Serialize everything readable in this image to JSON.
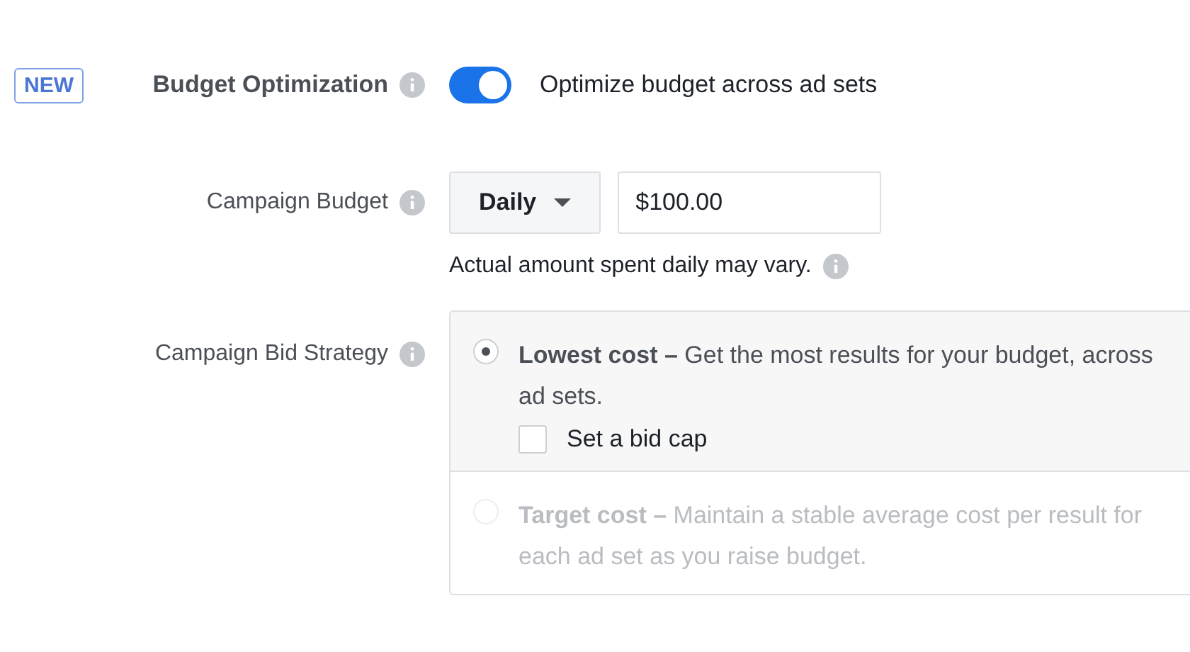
{
  "optimization": {
    "badge": "NEW",
    "label": "Budget Optimization",
    "toggle": {
      "on": true
    },
    "toggle_label": "Optimize budget across ad sets"
  },
  "budget": {
    "label": "Campaign Budget",
    "period": "Daily",
    "amount": "$100.00",
    "hint": "Actual amount spent daily may vary."
  },
  "bid_strategy": {
    "label": "Campaign Bid Strategy",
    "options": [
      {
        "text": "**Lowest cost –** Get the most results for your budget, across ad sets.",
        "selected": true,
        "disabled": false,
        "bid_cap": {
          "label": "Set a bid cap",
          "checked": false
        }
      },
      {
        "text": "**Target cost –** Maintain a stable average cost per result for each ad set as you raise budget.",
        "selected": false,
        "disabled": true
      }
    ]
  }
}
